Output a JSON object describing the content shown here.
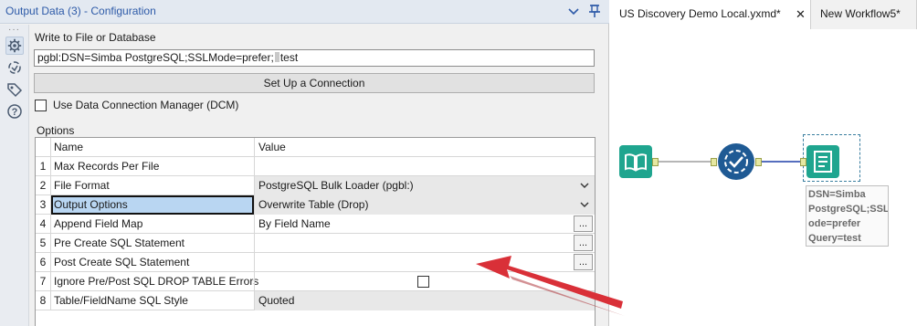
{
  "config": {
    "title": "Output Data (3) - Configuration",
    "write_label": "Write to File or Database",
    "connection_value": "pgbl:DSN=Simba PostgreSQL;SSLMode=prefer;",
    "connection_tail": "test",
    "setup_button": "Set Up a Connection",
    "dcm_label": "Use Data Connection Manager (DCM)",
    "dcm_checked": false,
    "options_label": "Options"
  },
  "grid": {
    "headers": {
      "name": "Name",
      "value": "Value"
    },
    "rows": [
      {
        "num": "1",
        "name": "Max Records Per File",
        "value": ""
      },
      {
        "num": "2",
        "name": "File Format",
        "value": "PostgreSQL Bulk Loader (pgbl:)"
      },
      {
        "num": "3",
        "name": "Output Options",
        "value": "Overwrite Table (Drop)"
      },
      {
        "num": "4",
        "name": "Append Field Map",
        "value": "By Field Name"
      },
      {
        "num": "5",
        "name": "Pre Create SQL Statement",
        "value": ""
      },
      {
        "num": "6",
        "name": "Post Create SQL Statement",
        "value": ""
      },
      {
        "num": "7",
        "name": "Ignore Pre/Post SQL DROP TABLE Errors",
        "value": ""
      },
      {
        "num": "8",
        "name": "Table/FieldName SQL Style",
        "value": "Quoted"
      }
    ],
    "ellipsis_label": "..."
  },
  "tabs": [
    {
      "label": "US Discovery Demo Local.yxmd*",
      "close": "✕"
    },
    {
      "label": "New Workflow5*",
      "close": ""
    }
  ],
  "canvas": {
    "annotation": "DSN=Simba\nPostgreSQL;SSLM\node=prefer\nQuery=test"
  },
  "colors": {
    "accent_title": "#2d5aa8",
    "tool_teal": "#1fa58f",
    "tool_blue": "#1f5a94",
    "selection": "#b9d6f2",
    "arrow_red": "#e8393f"
  },
  "icons": [
    "chevron-down-icon",
    "pin-icon",
    "gear-icon",
    "connection-icon",
    "tag-icon",
    "help-icon",
    "dropdown-arrow-icon",
    "book-icon",
    "check-circle-icon",
    "output-doc-icon"
  ]
}
